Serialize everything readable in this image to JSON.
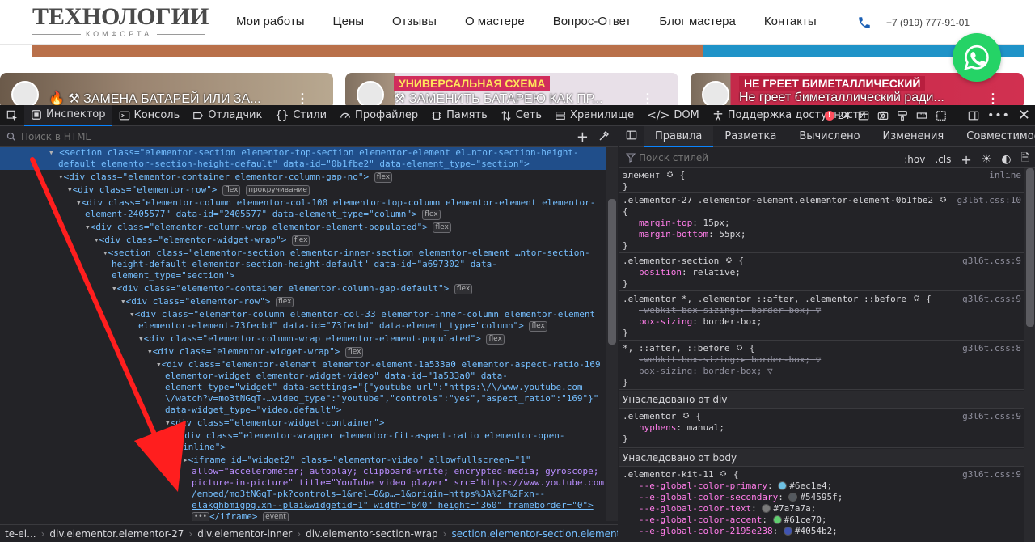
{
  "site": {
    "logo_title": "ТЕХНОЛОГИИ",
    "logo_sub": "КОМФОРТА",
    "nav": [
      "Мои работы",
      "Цены",
      "Отзывы",
      "О мастере",
      "Вопрос-Ответ",
      "Блог мастера",
      "Контакты"
    ],
    "phone": "+7 (919) 777-91-01",
    "cards": [
      {
        "title": "🔥 ⚒ ЗАМЕНА БАТАРЕЙ ИЛИ ЗА...",
        "banner": ""
      },
      {
        "title": "⚒ ЗАМЕНИТЬ БАТАРЕЮ КАК ПР...",
        "banner": "УНИВЕРСАЛЬНАЯ СХЕМА"
      },
      {
        "title": "Не греет биметаллический ради...",
        "banner": "НЕ ГРЕЕТ БИМЕТАЛЛИЧЕСКИЙ"
      }
    ],
    "whatsapp_icon": "whatsapp-icon"
  },
  "devtools": {
    "tabs": [
      {
        "label": "Инспектор",
        "icon": "inspector-icon"
      },
      {
        "label": "Консоль",
        "icon": "console-icon"
      },
      {
        "label": "Отладчик",
        "icon": "debugger-icon"
      },
      {
        "label": "Стили",
        "icon": "style-editor-icon"
      },
      {
        "label": "Профайлер",
        "icon": "profiler-icon"
      },
      {
        "label": "Память",
        "icon": "memory-icon"
      },
      {
        "label": "Сеть",
        "icon": "network-icon"
      },
      {
        "label": "Хранилище",
        "icon": "storage-icon"
      },
      {
        "label": "DOM",
        "icon": "dom-icon"
      },
      {
        "label": "Поддержка доступности",
        "icon": "accessibility-icon"
      }
    ],
    "error_count": "24",
    "search_placeholder": "Поиск в HTML",
    "right_tabs": [
      "Правила",
      "Разметка",
      "Вычислено",
      "Изменения",
      "Совместимость",
      "Шр"
    ],
    "filter_placeholder": "Поиск стилей",
    "hov": ":hov",
    "cls": ".cls",
    "breadcrumbs": [
      "te-el...",
      "div.elementor.elementor-27",
      "div.elementor-inner",
      "div.elementor-section-wrap",
      "section.elementor-section.elementor-top-..."
    ],
    "tree": [
      "<section class=\"elementor-section elementor-top-section elementor-element el…ntor-section-height-",
      "default elementor-section-height-default\" data-id=\"0b1fbe2\" data-element_type=\"section\">",
      "<div class=\"elementor-container elementor-column-gap-no\">",
      "<div class=\"elementor-row\">",
      "<div class=\"elementor-column elementor-col-100 elementor-top-column elementor-element elementor-",
      "element-2405577\" data-id=\"2405577\" data-element_type=\"column\">",
      "<div class=\"elementor-column-wrap elementor-element-populated\">",
      "<div class=\"elementor-widget-wrap\">",
      "<section class=\"elementor-section elementor-inner-section elementor-element …ntor-section-",
      "height-default elementor-section-height-default\" data-id=\"a697302\" data-",
      "element_type=\"section\">",
      "<div class=\"elementor-container elementor-column-gap-default\">",
      "<div class=\"elementor-row\">",
      "<div class=\"elementor-column elementor-col-33 elementor-inner-column elementor-element",
      "elementor-element-73fecbd\" data-id=\"73fecbd\" data-element_type=\"column\">",
      "<div class=\"elementor-column-wrap elementor-element-populated\">",
      "<div class=\"elementor-widget-wrap\">",
      "<div class=\"elementor-element elementor-element-1a533a0 elementor-aspect-ratio-169",
      "elementor-widget elementor-widget-video\" data-id=\"1a533a0\" data-",
      "element_type=\"widget\" data-settings=\"{\"youtube_url\":\"https:\\/\\/www.youtube.com",
      "\\/watch?v=mo3tNGqT-…video_type\":\"youtube\",\"controls\":\"yes\",\"aspect_ratio\":\"169\"}\"",
      "data-widget_type=\"video.default\">",
      "<div class=\"elementor-widget-container\">",
      "<div class=\"elementor-wrapper elementor-fit-aspect-ratio elementor-open-",
      "inline\">",
      "<iframe id=\"widget2\" class=\"elementor-video\" allowfullscreen=\"1\"",
      "allow=\"accelerometer; autoplay; clipboard-write; encrypted-media; gyroscope;",
      "picture-in-picture\" title=\"YouTube video player\" src=\"https://www.youtube.com",
      "/embed/mo3tNGqT-pk?controls=1&rel=0&p…=1&origin=https%3A%2F%2Fxn--",
      "elakghbmigpg.xn--plai&widgetid=1\" width=\"640\" height=\"360\" frameborder=\"0\">",
      "</iframe>"
    ],
    "badges": {
      "flex": "flex",
      "scroll": "прокручивание",
      "event": "event"
    },
    "rules": {
      "element_sel": "элемент",
      "inline": "inline",
      "r1_sel": ".elementor-27 .elementor-element.elementor-element-0b1fbe2",
      "r1_src": "g3l6t.css:10",
      "r1_d1_p": "margin-top",
      "r1_d1_v": "15px;",
      "r1_d2_p": "margin-bottom",
      "r1_d2_v": "55px;",
      "r2_sel": ".elementor-section",
      "r2_src": "g3l6t.css:9",
      "r2_d1_p": "position",
      "r2_d1_v": "relative;",
      "r3_sel": ".elementor *, .elementor ::after, .elementor ::before",
      "r3_src": "g3l6t.css:9",
      "r3_d1_p": "-webkit-box-sizing",
      "r3_d1_v": "border-box;",
      "r3_d2_p": "box-sizing",
      "r3_d2_v": "border-box;",
      "r4_sel": "*, ::after, ::before",
      "r4_src": "g3l6t.css:8",
      "r4_d1_p": "-webkit-box-sizing",
      "r4_d1_v": "border-box;",
      "r4_d2_p": "box-sizing",
      "r4_d2_v": "border-box;",
      "inh_div": "Унаследовано от div",
      "r5_sel": ".elementor",
      "r5_src": "g3l6t.css:9",
      "r5_d1_p": "hyphens",
      "r5_d1_v": "manual;",
      "inh_body": "Унаследовано от body",
      "r6_sel": ".elementor-kit-11",
      "r6_src": "g3l6t.css:9",
      "vars": [
        {
          "p": "--e-global-color-primary",
          "v": "#6ec1e4;",
          "c": "#6ec1e4"
        },
        {
          "p": "--e-global-color-secondary",
          "v": "#54595f;",
          "c": "#54595f"
        },
        {
          "p": "--e-global-color-text",
          "v": "#7a7a7a;",
          "c": "#7a7a7a"
        },
        {
          "p": "--e-global-color-accent",
          "v": "#61ce70;",
          "c": "#61ce70"
        },
        {
          "p": "--e-global-color-2195e238",
          "v": "#4054b2;",
          "c": "#4054b2"
        }
      ]
    }
  },
  "colors": {
    "accent": "#0a84ff",
    "devtools_bg": "#232327",
    "selected_row": "#204e8a",
    "arrow": "#ff1e1e"
  }
}
